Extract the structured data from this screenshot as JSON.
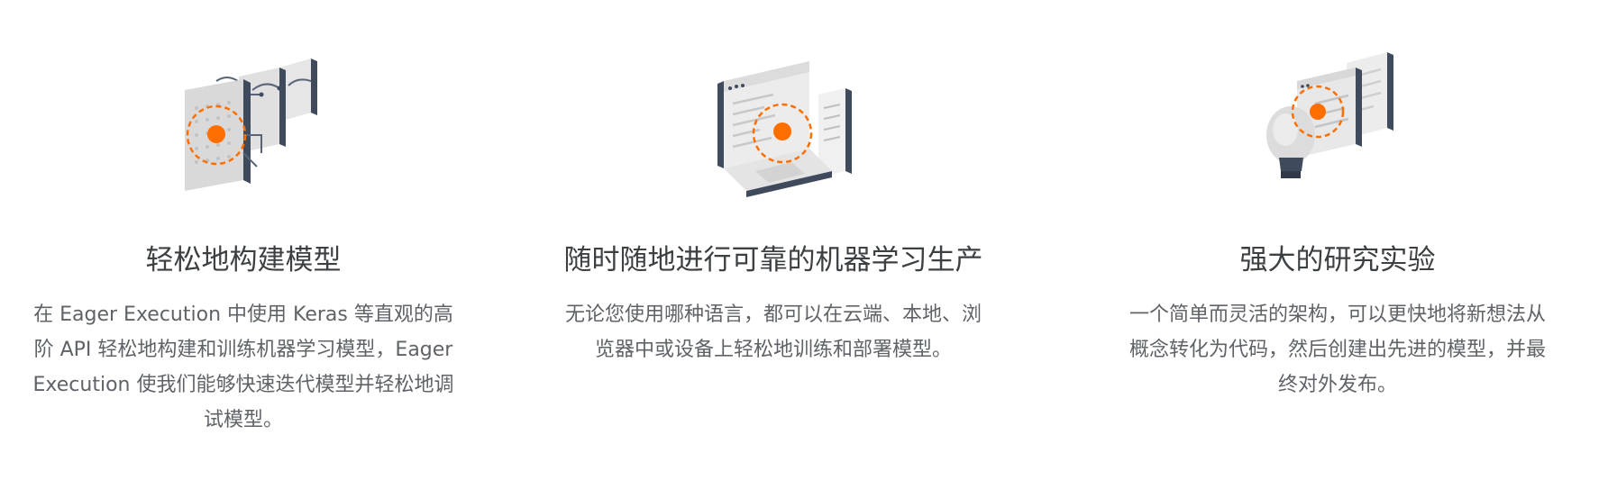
{
  "features": [
    {
      "title": "轻松地构建模型",
      "description": "在 Eager Execution 中使用 Keras 等直观的高阶 API 轻松地构建和训练机器学习模型，Eager Execution 使我们能够快速迭代模型并轻松地调试模型。",
      "icon": "layers-illustration-icon"
    },
    {
      "title": "随时随地进行可靠的机器学习生产",
      "description": "无论您使用哪种语言，都可以在云端、本地、浏览器中或设备上轻松地训练和部署模型。",
      "icon": "laptop-illustration-icon"
    },
    {
      "title": "强大的研究实验",
      "description": "一个简单而灵活的架构，可以更快地将新想法从概念转化为代码，然后创建出先进的模型，并最终对外发布。",
      "icon": "lightbulb-illustration-icon"
    }
  ],
  "colors": {
    "accent": "#ff6f00",
    "dark": "#3f4a5c",
    "light": "#e8e8e8",
    "title_text": "#3c4043",
    "body_text": "#5f6368"
  }
}
